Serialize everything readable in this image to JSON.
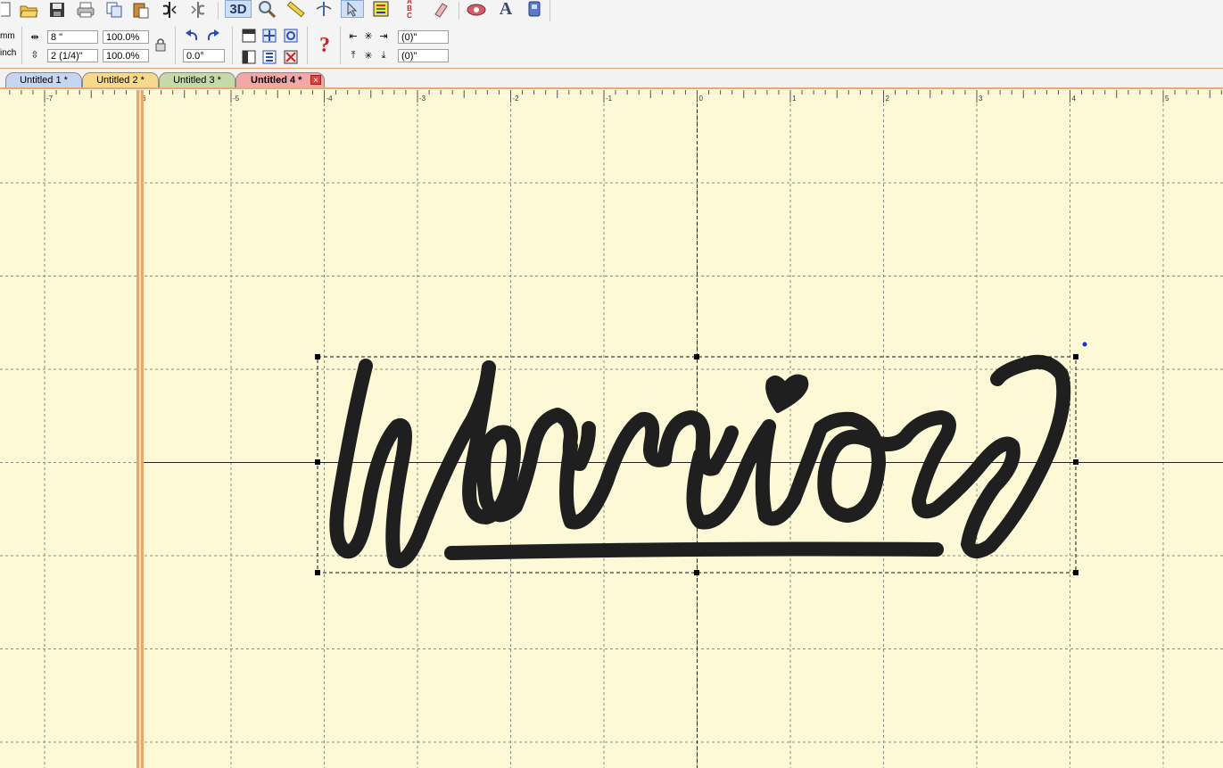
{
  "toolbar": {
    "top_icons": [
      {
        "name": "open-folder-icon"
      },
      {
        "name": "save-icon"
      },
      {
        "name": "print-icon"
      },
      {
        "name": "copy-icon"
      },
      {
        "name": "paste-icon"
      },
      {
        "name": "mirror-horizontal-icon"
      },
      {
        "name": "mirror-vertical-icon"
      },
      {
        "name": "view-3d-button",
        "label": "3D"
      },
      {
        "name": "zoom-icon"
      },
      {
        "name": "measure-icon"
      },
      {
        "name": "needle-icon"
      },
      {
        "name": "select-pointer-icon"
      },
      {
        "name": "color-chart-icon"
      },
      {
        "name": "abc-spell-icon"
      },
      {
        "name": "eraser-icon"
      },
      {
        "name": "machine-icon"
      },
      {
        "name": "text-tool-icon",
        "label": "A"
      },
      {
        "name": "transfer-icon"
      }
    ],
    "unit_mm": "mm",
    "unit_inch": "inch",
    "width_value": "8 \"",
    "height_value": "2 (1/4)\"",
    "width_percent": "100.0%",
    "height_percent": "100.0%",
    "rotation_value": "0.0°",
    "offset_x_value": "(0)\"",
    "offset_y_value": "(0)\"",
    "help_label": "?"
  },
  "tabs": [
    {
      "label": "Untitled 1 *",
      "color": "#c7d6f0"
    },
    {
      "label": "Untitled 2 *",
      "color": "#f6d98a"
    },
    {
      "label": "Untitled 3 *",
      "color": "#c6d9a8"
    },
    {
      "label": "Untitled 4 *",
      "color": "#f2a8a8",
      "active": true
    }
  ],
  "tab_close_label": "×",
  "ruler": {
    "labels": [
      "-7",
      "-6",
      "-5",
      "-4",
      "-3",
      "-2",
      "-1",
      "0",
      "1",
      "2",
      "3",
      "4",
      "5"
    ]
  },
  "design": {
    "text": "Warriors",
    "thread_color": "#1f1f1f"
  },
  "colors": {
    "canvas_bg": "#fdf8d6",
    "grid_line": "#8a8a7a",
    "hoop_border": "#e8a86a",
    "selection_handle": "#000000"
  }
}
